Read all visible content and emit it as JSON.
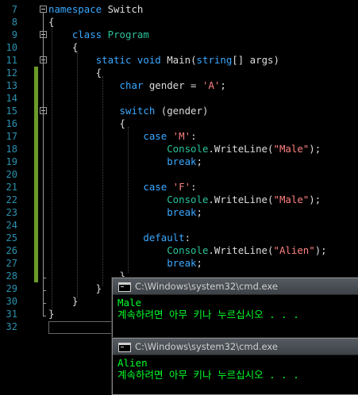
{
  "editor": {
    "lines": [
      {
        "num": "7",
        "tokens": [
          {
            "t": "namespace",
            "c": "kw"
          },
          {
            "t": " Switch",
            "c": "plain"
          }
        ]
      },
      {
        "num": "8",
        "tokens": [
          {
            "t": "{",
            "c": "plain"
          }
        ]
      },
      {
        "num": "9",
        "tokens": [
          {
            "t": "    ",
            "c": "plain"
          },
          {
            "t": "class",
            "c": "kw"
          },
          {
            "t": " ",
            "c": "plain"
          },
          {
            "t": "Program",
            "c": "type"
          }
        ]
      },
      {
        "num": "10",
        "tokens": [
          {
            "t": "    {",
            "c": "plain"
          }
        ]
      },
      {
        "num": "11",
        "tokens": [
          {
            "t": "        ",
            "c": "plain"
          },
          {
            "t": "static",
            "c": "kw"
          },
          {
            "t": " ",
            "c": "plain"
          },
          {
            "t": "void",
            "c": "kw"
          },
          {
            "t": " Main(",
            "c": "plain"
          },
          {
            "t": "string",
            "c": "kw"
          },
          {
            "t": "[] args)",
            "c": "plain"
          }
        ]
      },
      {
        "num": "12",
        "tokens": [
          {
            "t": "        {",
            "c": "plain"
          }
        ]
      },
      {
        "num": "13",
        "tokens": [
          {
            "t": "            ",
            "c": "plain"
          },
          {
            "t": "char",
            "c": "kw"
          },
          {
            "t": " gender = ",
            "c": "plain"
          },
          {
            "t": "'A'",
            "c": "str"
          },
          {
            "t": ";",
            "c": "plain"
          }
        ]
      },
      {
        "num": "14",
        "tokens": []
      },
      {
        "num": "15",
        "tokens": [
          {
            "t": "            ",
            "c": "plain"
          },
          {
            "t": "switch",
            "c": "kw"
          },
          {
            "t": " (gender)",
            "c": "plain"
          }
        ]
      },
      {
        "num": "16",
        "tokens": [
          {
            "t": "            {",
            "c": "plain"
          }
        ]
      },
      {
        "num": "17",
        "tokens": [
          {
            "t": "                ",
            "c": "plain"
          },
          {
            "t": "case",
            "c": "kw"
          },
          {
            "t": " ",
            "c": "plain"
          },
          {
            "t": "'M'",
            "c": "str"
          },
          {
            "t": ":",
            "c": "plain"
          }
        ]
      },
      {
        "num": "18",
        "tokens": [
          {
            "t": "                    ",
            "c": "plain"
          },
          {
            "t": "Console",
            "c": "type"
          },
          {
            "t": ".WriteLine(",
            "c": "plain"
          },
          {
            "t": "\"Male\"",
            "c": "str"
          },
          {
            "t": ");",
            "c": "plain"
          }
        ]
      },
      {
        "num": "19",
        "tokens": [
          {
            "t": "                    ",
            "c": "plain"
          },
          {
            "t": "break",
            "c": "kw"
          },
          {
            "t": ";",
            "c": "plain"
          }
        ]
      },
      {
        "num": "20",
        "tokens": []
      },
      {
        "num": "21",
        "tokens": [
          {
            "t": "                ",
            "c": "plain"
          },
          {
            "t": "case",
            "c": "kw"
          },
          {
            "t": " ",
            "c": "plain"
          },
          {
            "t": "'F'",
            "c": "str"
          },
          {
            "t": ":",
            "c": "plain"
          }
        ]
      },
      {
        "num": "22",
        "tokens": [
          {
            "t": "                    ",
            "c": "plain"
          },
          {
            "t": "Console",
            "c": "type"
          },
          {
            "t": ".WriteLine(",
            "c": "plain"
          },
          {
            "t": "\"Male\"",
            "c": "str"
          },
          {
            "t": ");",
            "c": "plain"
          }
        ]
      },
      {
        "num": "23",
        "tokens": [
          {
            "t": "                    ",
            "c": "plain"
          },
          {
            "t": "break",
            "c": "kw"
          },
          {
            "t": ";",
            "c": "plain"
          }
        ]
      },
      {
        "num": "24",
        "tokens": []
      },
      {
        "num": "25",
        "tokens": [
          {
            "t": "                ",
            "c": "plain"
          },
          {
            "t": "default",
            "c": "kw"
          },
          {
            "t": ":",
            "c": "plain"
          }
        ]
      },
      {
        "num": "26",
        "tokens": [
          {
            "t": "                    ",
            "c": "plain"
          },
          {
            "t": "Console",
            "c": "type"
          },
          {
            "t": ".WriteLine(",
            "c": "plain"
          },
          {
            "t": "\"Alien\"",
            "c": "str"
          },
          {
            "t": ");",
            "c": "plain"
          }
        ]
      },
      {
        "num": "27",
        "tokens": [
          {
            "t": "                    ",
            "c": "plain"
          },
          {
            "t": "break",
            "c": "kw"
          },
          {
            "t": ";",
            "c": "plain"
          }
        ]
      },
      {
        "num": "28",
        "tokens": [
          {
            "t": "            }",
            "c": "plain"
          }
        ]
      },
      {
        "num": "29",
        "tokens": [
          {
            "t": "        }",
            "c": "plain"
          }
        ]
      },
      {
        "num": "30",
        "tokens": [
          {
            "t": "    }",
            "c": "plain"
          }
        ]
      },
      {
        "num": "31",
        "tokens": [
          {
            "t": "}",
            "c": "plain"
          }
        ]
      },
      {
        "num": "32",
        "tokens": []
      }
    ]
  },
  "console_windows": [
    {
      "title": "C:\\Windows\\system32\\cmd.exe",
      "lines": [
        "Male",
        "계속하려면 아무 키나 누르십시오 . . ."
      ]
    },
    {
      "title": "C:\\Windows\\system32\\cmd.exe",
      "lines": [
        "Alien",
        "계속하려면 아무 키나 누르십시오 . . ."
      ]
    }
  ],
  "colors": {
    "keyword": "#3aa8ff",
    "type": "#2bc29b",
    "string": "#ff8080",
    "line_number": "#2b91af",
    "console_text": "#00ff2a",
    "change_bar": "#6a9a28"
  }
}
